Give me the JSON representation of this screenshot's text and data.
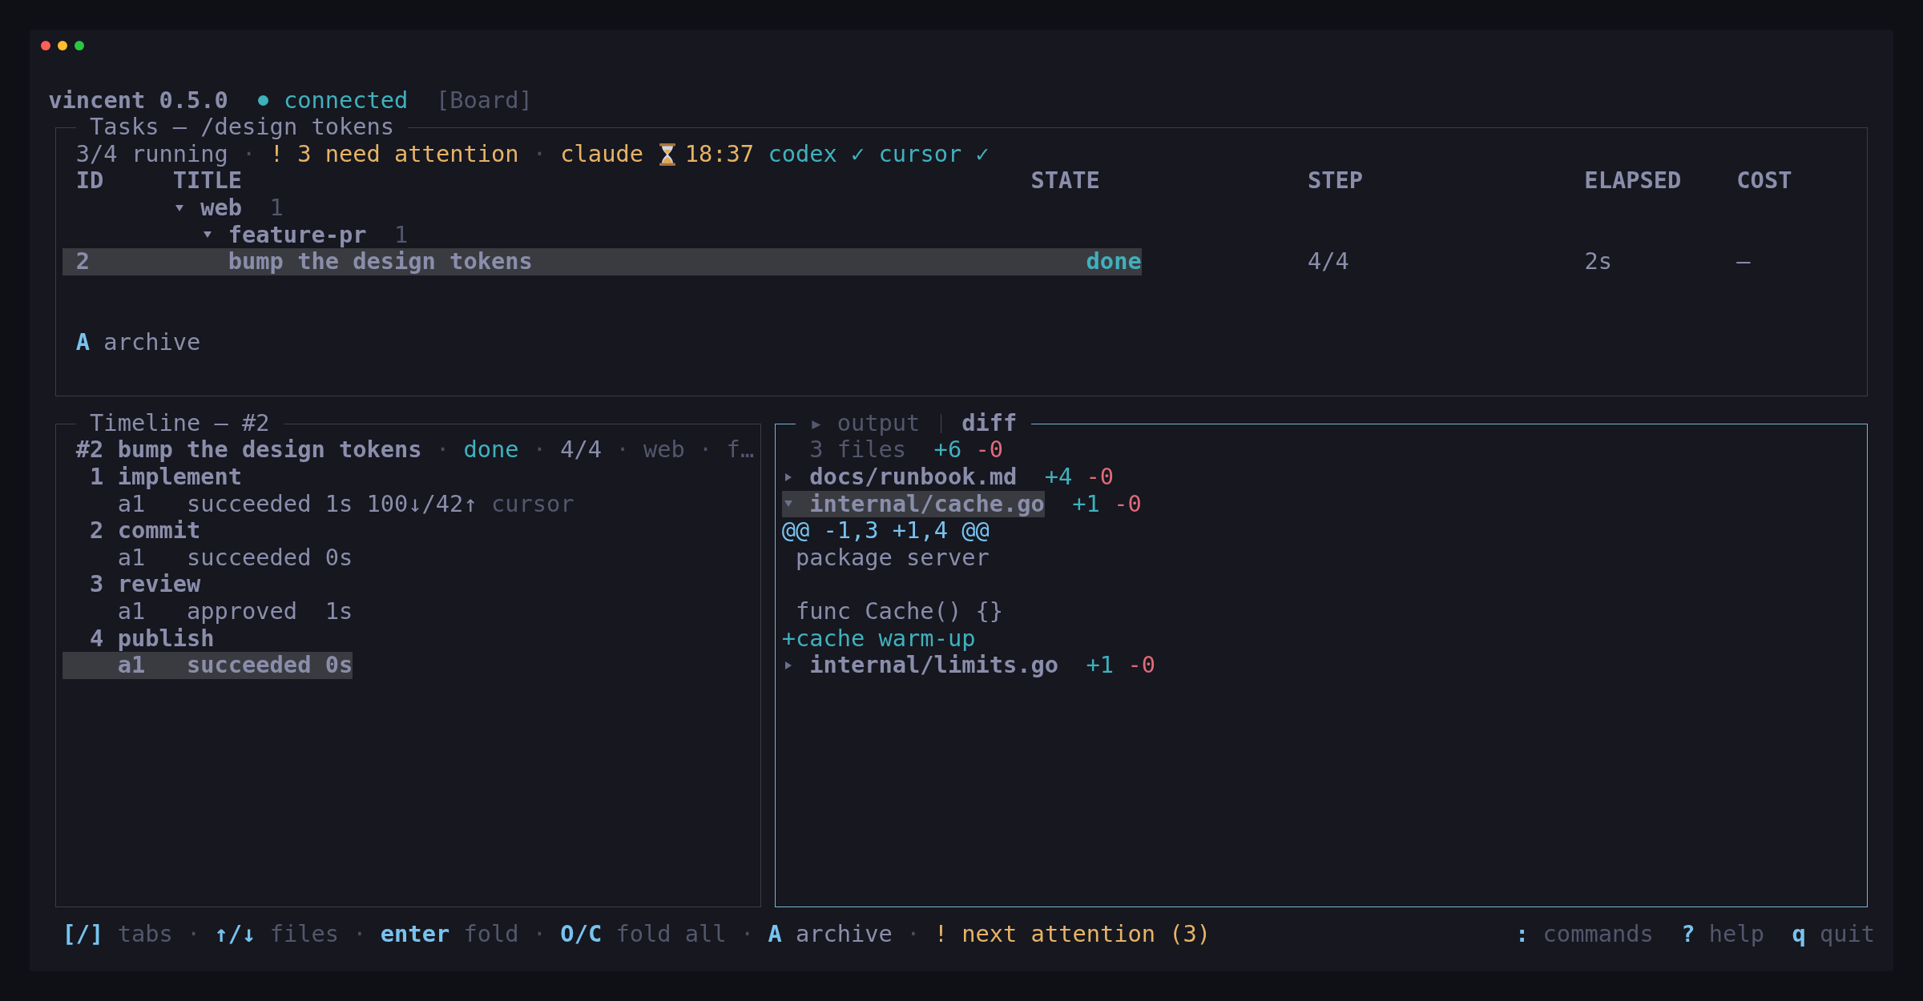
{
  "window": {
    "controls": [
      {
        "color": "#ff5f57"
      },
      {
        "color": "#febc2e"
      },
      {
        "color": "#28c840"
      }
    ]
  },
  "header": {
    "app": "vincent 0.5.0",
    "connection": {
      "label": "connected",
      "connected": true
    },
    "view": "[Board]"
  },
  "tasks_panel": {
    "title": "Tasks — /design tokens",
    "focused": false,
    "status_line": [
      {
        "kind": "count",
        "text": "3/4 running"
      },
      {
        "kind": "separator",
        "text": "·"
      },
      {
        "kind": "attention",
        "text": "! 3 need attention"
      },
      {
        "kind": "separator",
        "text": "·"
      },
      {
        "kind": "agent",
        "name": "claude",
        "color": "#e6b366",
        "timer": "18:37"
      },
      {
        "kind": "agent",
        "name": "codex",
        "color": "#3fb1bd",
        "mark": "✓"
      },
      {
        "kind": "agent",
        "name": "cursor",
        "color": "#3fb1bd",
        "mark": "✓"
      }
    ],
    "table": {
      "columns": [
        "ID",
        "TITLE",
        "STATE",
        "STEP",
        "ELAPSED",
        "COST"
      ],
      "rows": [
        {
          "kind": "group",
          "label": "web",
          "count": "1",
          "expanded": true,
          "selected": false,
          "children": [
            {
              "kind": "group",
              "label": "feature-pr",
              "count": "1",
              "expanded": true,
              "selected": false,
              "children": [
                {
                  "kind": "task",
                  "id": "2",
                  "title": "bump the design tokens",
                  "state": "done",
                  "step": "4/4",
                  "elapsed": "2s",
                  "cost": "–",
                  "selected": true
                }
              ]
            }
          ]
        }
      ]
    },
    "actions": [
      {
        "key": "A",
        "label": "archive"
      }
    ]
  },
  "timeline_panel": {
    "title": "Timeline — #2",
    "focused": false,
    "summary": [
      {
        "kind": "title",
        "text": "#2 bump the design tokens"
      },
      {
        "kind": "separator",
        "text": "·"
      },
      {
        "kind": "state",
        "text": "done"
      },
      {
        "kind": "separator",
        "text": "·"
      },
      {
        "kind": "plain",
        "text": "4/4"
      },
      {
        "kind": "separator",
        "text": "·"
      },
      {
        "kind": "muted",
        "text": "web"
      },
      {
        "kind": "separator",
        "text": "·"
      },
      {
        "kind": "muted",
        "text": "f…"
      }
    ],
    "steps": [
      {
        "number": "1",
        "name": "implement",
        "attempts": [
          {
            "agent": "a1",
            "result": "succeeded",
            "duration": "1s",
            "tokens": "100↓/42↑",
            "runner": "cursor",
            "selected": false
          }
        ]
      },
      {
        "number": "2",
        "name": "commit",
        "attempts": [
          {
            "agent": "a1",
            "result": "succeeded",
            "duration": "0s",
            "selected": false
          }
        ]
      },
      {
        "number": "3",
        "name": "review",
        "attempts": [
          {
            "agent": "a1",
            "result": "approved",
            "duration": "1s",
            "selected": false
          }
        ]
      },
      {
        "number": "4",
        "name": "publish",
        "attempts": [
          {
            "agent": "a1",
            "result": "succeeded",
            "duration": "0s",
            "selected": true
          }
        ]
      }
    ]
  },
  "diff_panel": {
    "focused": true,
    "tabs": [
      {
        "label": "▸ output",
        "selected": false
      },
      {
        "label": "diff",
        "selected": true
      }
    ],
    "summary": {
      "files": "3 files",
      "added": "+6",
      "removed": "-0"
    },
    "files": [
      {
        "path": "docs/runbook.md",
        "added": "+4",
        "removed": "-0",
        "expanded": false,
        "selected": false
      },
      {
        "path": "internal/cache.go",
        "added": "+1",
        "removed": "-0",
        "expanded": true,
        "selected": true,
        "hunks": [
          {
            "header": "@@ -1,3 +1,4 @@",
            "lines": [
              {
                "kind": "context",
                "text": "package server"
              },
              {
                "kind": "blank"
              },
              {
                "kind": "context",
                "text": "func Cache() {}"
              },
              {
                "kind": "added",
                "text": "+cache warm-up"
              }
            ]
          }
        ]
      },
      {
        "path": "internal/limits.go",
        "added": "+1",
        "removed": "-0",
        "expanded": false,
        "selected": false
      }
    ]
  },
  "footer": {
    "separator": "·",
    "hints": [
      {
        "key": "[/]",
        "label": "tabs",
        "kind": "nav"
      },
      {
        "key": "↑/↓",
        "label": "files",
        "kind": "nav"
      },
      {
        "key": "enter",
        "label": "fold",
        "kind": "nav"
      },
      {
        "key": "O/C",
        "label": "fold all",
        "kind": "nav"
      },
      {
        "key": "A",
        "label": "archive",
        "kind": "action"
      },
      {
        "key": "!",
        "label": "next attention (3)",
        "kind": "attention"
      }
    ],
    "global_hints": [
      {
        "key": ":",
        "label": "commands"
      },
      {
        "key": "?",
        "label": "help"
      },
      {
        "key": "q",
        "label": "quit"
      }
    ]
  }
}
